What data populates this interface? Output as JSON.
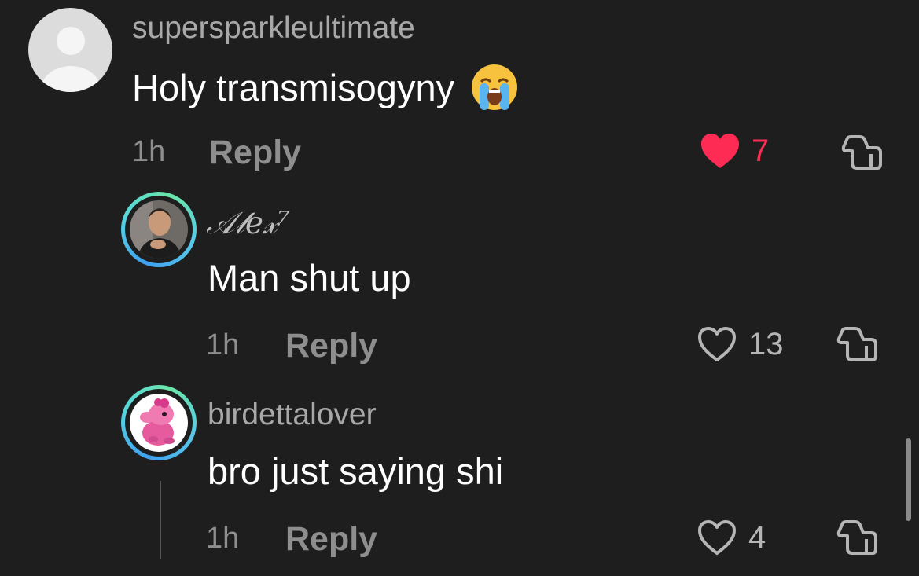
{
  "comments": [
    {
      "username": "supersparkleultimate",
      "text": "Holy transmisogyny",
      "emoji": "loudly-crying-face",
      "time": "1h",
      "reply_label": "Reply",
      "likes": "7",
      "liked": true,
      "avatar": "default-avatar"
    },
    {
      "username": "𝒜𝓁𝑒𝓍⁷",
      "text": "Man shut up",
      "time": "1h",
      "reply_label": "Reply",
      "likes": "13",
      "liked": false,
      "avatar": "profile-photo-man"
    },
    {
      "username": "birdettalover",
      "text": "bro just saying shi",
      "time": "1h",
      "reply_label": "Reply",
      "likes": "4",
      "liked": false,
      "avatar": "birdetta-character"
    }
  ],
  "colors": {
    "background": "#1e1e1e",
    "like_red": "#fe2c55",
    "muted_text": "#8e8e8e",
    "avatar_ring_start": "#3fa0f0",
    "avatar_ring_end": "#6be6a8"
  },
  "icons": {
    "like": "heart-icon",
    "dislike": "thumbs-down-icon"
  }
}
